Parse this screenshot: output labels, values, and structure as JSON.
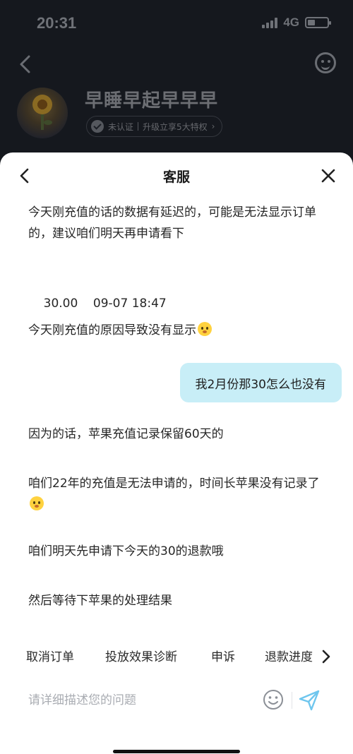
{
  "status_bar": {
    "time": "20:31",
    "network": "4G"
  },
  "background_page": {
    "username": "早睡早起早早早",
    "verify_status": "未认证",
    "upgrade_text": "升级立享5大特权",
    "upgrade_chevron": "›"
  },
  "sheet": {
    "title": "客服"
  },
  "messages": [
    {
      "from": "agent",
      "text": "今天刚充值的话的数据有延迟的，可能是无法显示订单的，建议咱们明天再申请看下"
    },
    {
      "from": "agent",
      "text": "30.00    09-07 18:47"
    },
    {
      "from": "agent",
      "text": "今天刚充值的原因导致没有显示",
      "emoji": "sweat-smile-emoji"
    },
    {
      "from": "user",
      "text": "我2月份那30怎么也没有"
    },
    {
      "from": "agent",
      "text": "因为的话，苹果充值记录保留60天的"
    },
    {
      "from": "agent",
      "text": "咱们22年的充值是无法申请的，时间长苹果没有记录了",
      "emoji": "sweat-smile-emoji"
    },
    {
      "from": "agent",
      "text": "咱们明天先申请下今天的30的退款哦"
    },
    {
      "from": "agent",
      "text": "然后等待下苹果的处理结果"
    }
  ],
  "quick_actions": [
    "取消订单",
    "投放效果诊断",
    "申诉",
    "退款进度"
  ],
  "input": {
    "placeholder": "请详细描述您的问题"
  },
  "colors": {
    "user_bubble": "#c8eef7",
    "send_accent": "#6ec6ee",
    "overlay": "#15181e"
  }
}
